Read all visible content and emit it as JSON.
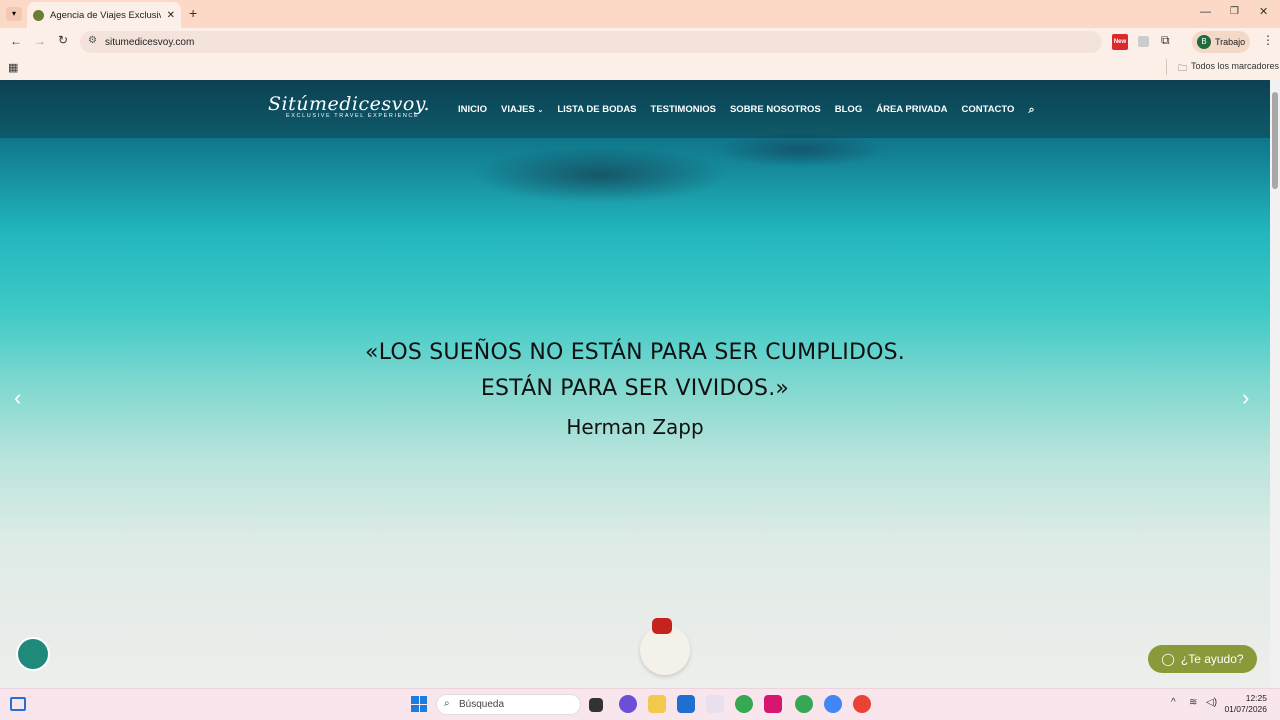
{
  "browser": {
    "tab_title": "Agencia de Viajes Exclusivos | S",
    "url": "situmedicesvoy.com",
    "profile_label": "Trabajo",
    "profile_initial": "B",
    "bookmarks_label": "Todos los marcadores",
    "new_badge": "New"
  },
  "site": {
    "logo_script": "Sitúmedicesvoy.",
    "logo_tagline": "EXCLUSIVE TRAVEL EXPERIENCE",
    "nav": [
      "INICIO",
      "VIAJES",
      "LISTA DE BODAS",
      "TESTIMONIOS",
      "SOBRE NOSOTROS",
      "BLOG",
      "ÁREA PRIVADA",
      "CONTACTO"
    ],
    "quote_line1": "«LOS SUEÑOS NO ESTÁN PARA SER CUMPLIDOS.",
    "quote_line2": "ESTÁN PARA SER VIVIDOS.»",
    "quote_author": "Herman Zapp",
    "help_label": "¿Te ayudo?"
  },
  "taskbar": {
    "search_placeholder": "Búsqueda",
    "time": "12:25",
    "date": "01/07/2026"
  },
  "colors": {
    "tabbar": "#fbd9c6",
    "help_button": "#8a9a3a",
    "accessibility": "#1f8a7c"
  }
}
